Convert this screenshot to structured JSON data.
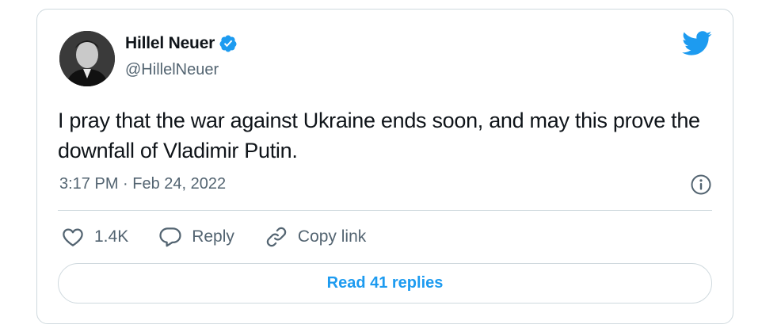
{
  "author": {
    "name": "Hillel Neuer",
    "handle": "@HillelNeuer",
    "avatar_icon": "profile-photo",
    "verified_icon": "verified-badge-icon"
  },
  "tweet": {
    "text": "I pray that the war against Ukraine ends soon, and may this prove the downfall of Vladimir Putin.",
    "timestamp": "3:17 PM · Feb 24, 2022"
  },
  "actions": {
    "like_count": "1.4K",
    "reply_label": "Reply",
    "copy_link_label": "Copy link"
  },
  "read_replies_label": "Read 41 replies",
  "colors": {
    "accent": "#1d9bf0",
    "text": "#0f1419",
    "secondary": "#536471",
    "border": "#cfd9de"
  }
}
